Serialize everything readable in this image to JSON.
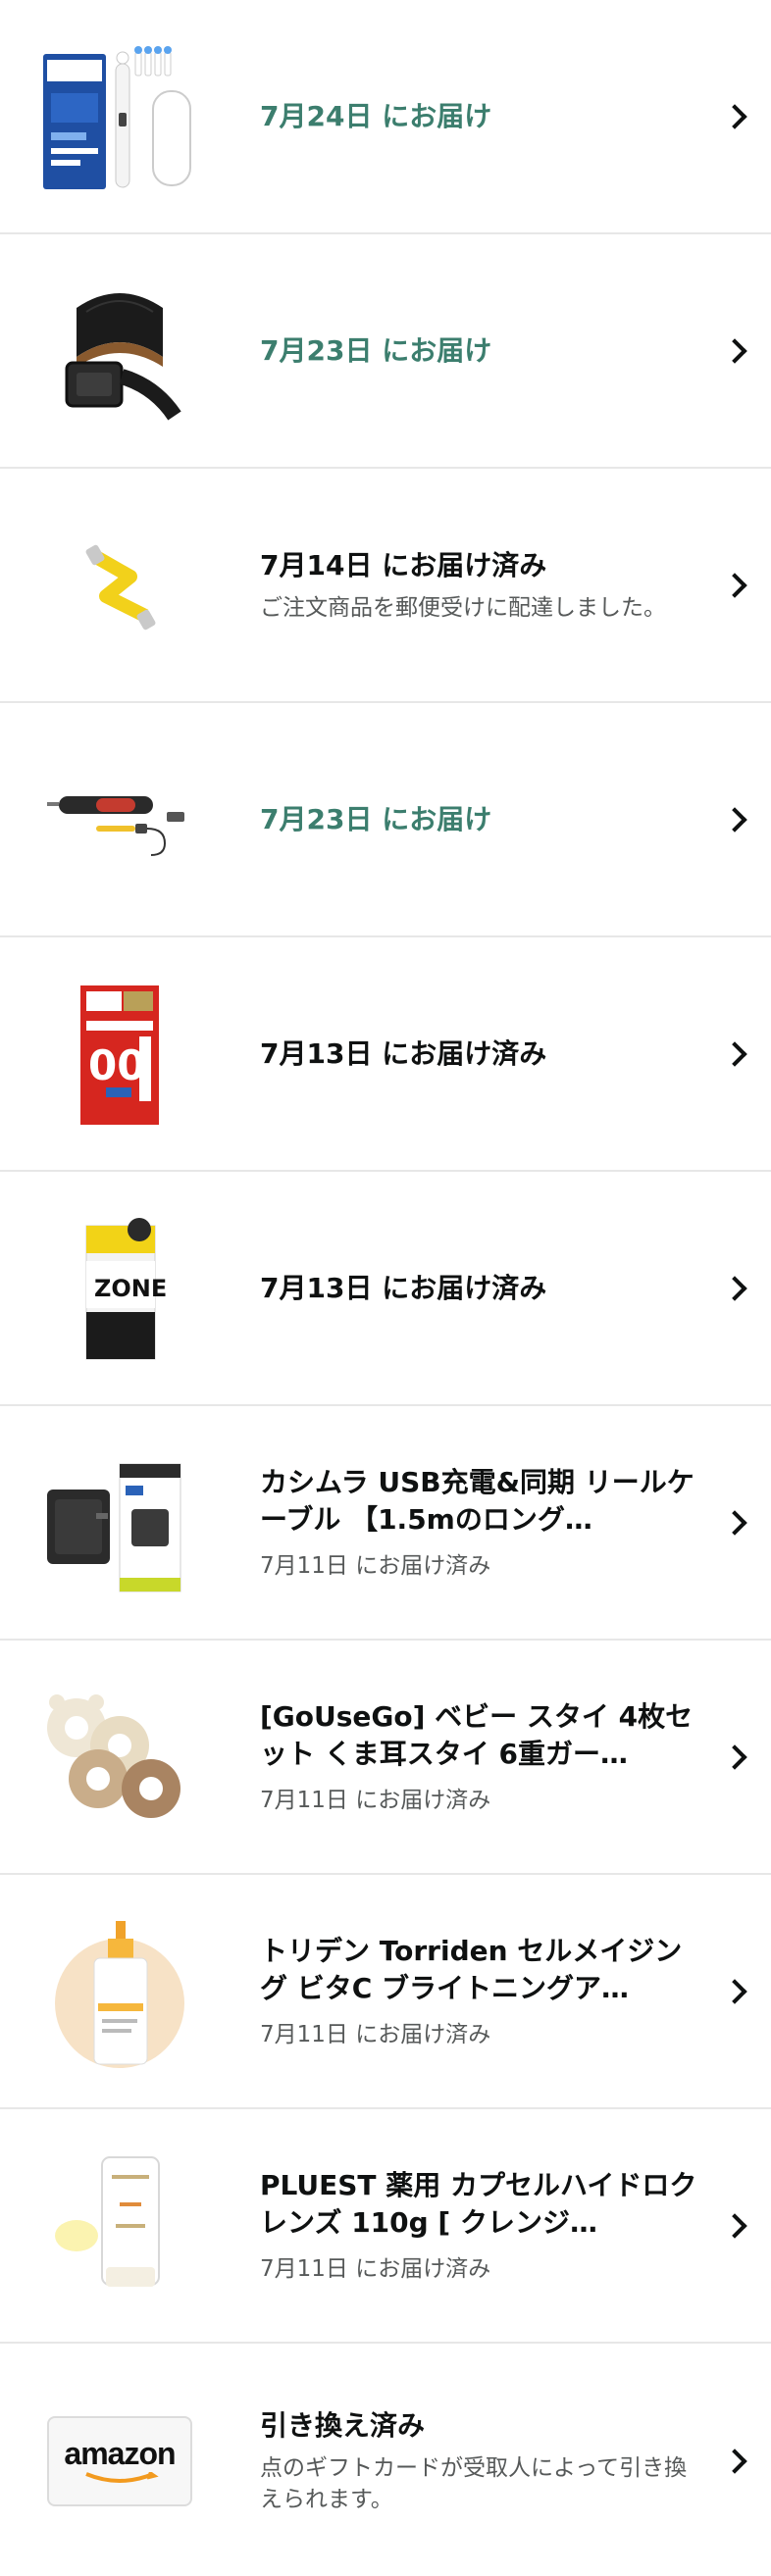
{
  "orders": [
    {
      "headline": "7月24日 にお届け",
      "status_color": "green",
      "title": "",
      "subtext": "",
      "thumb_icon": "electric-toothbrush-icon"
    },
    {
      "headline": "7月23日 にお届け",
      "status_color": "green",
      "title": "",
      "subtext": "",
      "thumb_icon": "leather-belt-icon"
    },
    {
      "headline": "7月14日 にお届け済み",
      "status_color": "dark",
      "title": "",
      "subtext": "ご注文商品を郵便受けに配達しました。",
      "thumb_icon": "usb-cable-icon"
    },
    {
      "headline": "7月23日 にお届け",
      "status_color": "green",
      "title": "",
      "subtext": "",
      "thumb_icon": "electric-screwdriver-icon"
    },
    {
      "headline": "7月13日 にお届け済み",
      "status_color": "dark",
      "title": "",
      "subtext": "",
      "thumb_icon": "product-box-red-icon"
    },
    {
      "headline": "7月13日 にお届け済み",
      "status_color": "dark",
      "title": "",
      "subtext": "",
      "thumb_icon": "product-box-zone-icon"
    },
    {
      "headline": "",
      "status_color": "dark",
      "title": "カシムラ USB充電&同期 リールケーブル 【1.5mのロング…",
      "subtext": "7月11日 にお届け済み",
      "thumb_icon": "usb-charger-icon"
    },
    {
      "headline": "",
      "status_color": "dark",
      "title": "[GoUseGo] ベビー スタイ 4枚セット くま耳スタイ 6重ガー…",
      "subtext": "7月11日 にお届け済み",
      "thumb_icon": "baby-bib-icon"
    },
    {
      "headline": "",
      "status_color": "dark",
      "title": "トリデン Torriden セルメイジング ビタC ブライトニングア…",
      "subtext": "7月11日 にお届け済み",
      "thumb_icon": "serum-bottle-icon"
    },
    {
      "headline": "",
      "status_color": "dark",
      "title": "PLUEST 薬用 カプセルハイドロクレンズ 110g [ クレンジ…",
      "subtext": "7月11日 にお届け済み",
      "thumb_icon": "cleanser-tube-icon"
    },
    {
      "headline": "引き換え済み",
      "status_color": "dark",
      "title": "",
      "subtext": "点のギフトカードが受取人によって引き換えられます。",
      "thumb_icon": "amazon-gift-card-icon",
      "thumb_text": "amazon"
    }
  ],
  "colors": {
    "green_status": "#3c7e6e",
    "text_primary": "#0f1111",
    "text_secondary": "#565959",
    "divider": "#e7e7e7"
  }
}
